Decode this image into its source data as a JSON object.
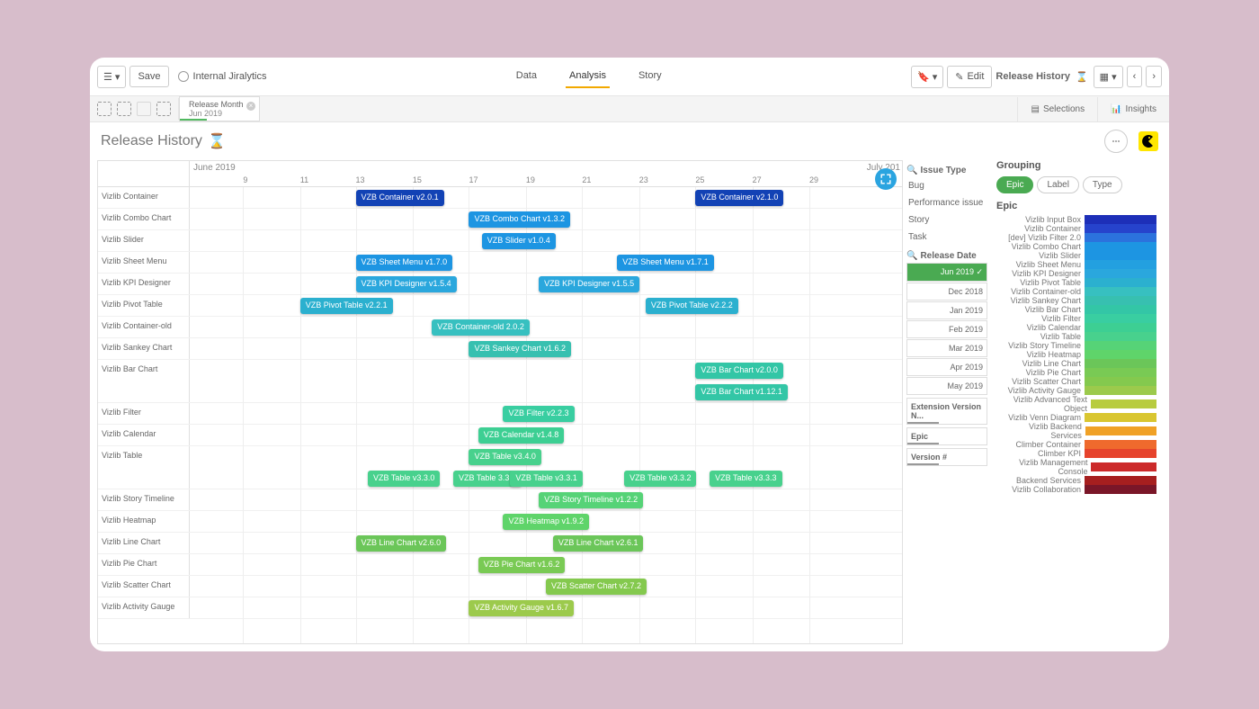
{
  "toolbar": {
    "save": "Save",
    "app": "Internal Jiralytics",
    "nav": [
      "Data",
      "Analysis",
      "Story"
    ],
    "edit": "Edit",
    "crumb": "Release History",
    "selections": "Selections",
    "insights": "Insights"
  },
  "chip": {
    "label": "Release Month",
    "value": "Jun 2019"
  },
  "title": "Release History",
  "axis": {
    "month": "June 2019",
    "month2": "July 201",
    "days": [
      {
        "d": "9",
        "p": 7.5
      },
      {
        "d": "11",
        "p": 15.5
      },
      {
        "d": "13",
        "p": 23.3
      },
      {
        "d": "15",
        "p": 31.3
      },
      {
        "d": "17",
        "p": 39.2
      },
      {
        "d": "19",
        "p": 47.2
      },
      {
        "d": "21",
        "p": 55.1
      },
      {
        "d": "23",
        "p": 63.1
      },
      {
        "d": "25",
        "p": 71.0
      },
      {
        "d": "27",
        "p": 79.0
      },
      {
        "d": "29",
        "p": 87.0
      }
    ]
  },
  "rows": [
    {
      "label": "Vizlib Container",
      "h": 24,
      "ev": [
        {
          "t": "VZB Container v2.0.1",
          "x": 23.3,
          "c": "#1242b5"
        },
        {
          "t": "VZB Container v2.1.0",
          "x": 71.0,
          "c": "#1242b5"
        }
      ]
    },
    {
      "label": "Vizlib Combo Chart",
      "h": 24,
      "ev": [
        {
          "t": "VZB Combo Chart v1.3.2",
          "x": 39.2,
          "c": "#1d95e2"
        }
      ]
    },
    {
      "label": "Vizlib Slider",
      "h": 24,
      "ev": [
        {
          "t": "VZB Slider v1.0.4",
          "x": 41.0,
          "c": "#1d95e2"
        }
      ]
    },
    {
      "label": "Vizlib Sheet Menu",
      "h": 24,
      "ev": [
        {
          "t": "VZB Sheet Menu v1.7.0",
          "x": 23.3,
          "c": "#1d95e2"
        },
        {
          "t": "VZB Sheet Menu v1.7.1",
          "x": 60.0,
          "c": "#1d95e2"
        }
      ]
    },
    {
      "label": "Vizlib KPI Designer",
      "h": 24,
      "ev": [
        {
          "t": "VZB KPI Designer v1.5.4",
          "x": 23.3,
          "c": "#2aa7dd"
        },
        {
          "t": "VZB KPI Designer v1.5.5",
          "x": 49.0,
          "c": "#2aa7dd"
        }
      ]
    },
    {
      "label": "Vizlib Pivot Table",
      "h": 24,
      "ev": [
        {
          "t": "VZB Pivot Table v2.2.1",
          "x": 15.5,
          "c": "#2bb0cf"
        },
        {
          "t": "VZB Pivot Table v2.2.2",
          "x": 64.0,
          "c": "#2bb0cf"
        }
      ]
    },
    {
      "label": "Vizlib Container-old",
      "h": 24,
      "ev": [
        {
          "t": "VZB Container-old 2.0.2",
          "x": 34.0,
          "c": "#37c0c0"
        }
      ]
    },
    {
      "label": "Vizlib Sankey Chart",
      "h": 24,
      "ev": [
        {
          "t": "VZB Sankey Chart v1.6.2",
          "x": 39.2,
          "c": "#37c0b0"
        }
      ]
    },
    {
      "label": "Vizlib Bar Chart",
      "h": 48,
      "ev": [
        {
          "t": "VZB Bar Chart v2.0.0",
          "x": 71.0,
          "c": "#33c6a6"
        },
        {
          "t": "VZB Bar Chart v1.12.1",
          "x": 71.0,
          "y": 24,
          "c": "#33c6a6"
        }
      ]
    },
    {
      "label": "Vizlib Filter",
      "h": 24,
      "ev": [
        {
          "t": "VZB Filter v2.2.3",
          "x": 44.0,
          "c": "#39cea1"
        }
      ]
    },
    {
      "label": "Vizlib Calendar",
      "h": 24,
      "ev": [
        {
          "t": "VZB Calendar v1.4.8",
          "x": 40.5,
          "c": "#3dcf93"
        }
      ]
    },
    {
      "label": "Vizlib Table",
      "h": 48,
      "ev": [
        {
          "t": "VZB Table v3.4.0",
          "x": 39.2,
          "c": "#48d18d"
        },
        {
          "t": "VZB Table v3.3.0",
          "x": 25.0,
          "y": 24,
          "c": "#48d18d"
        },
        {
          "t": "VZB Table 3.3.0",
          "x": 37.0,
          "y": 24,
          "c": "#48d18d"
        },
        {
          "t": "VZB Table v3.3.1",
          "x": 45.0,
          "y": 24,
          "c": "#48d18d"
        },
        {
          "t": "VZB Table v3.3.2",
          "x": 61.0,
          "y": 24,
          "c": "#48d18d"
        },
        {
          "t": "VZB Table v3.3.3",
          "x": 73.0,
          "y": 24,
          "c": "#48d18d"
        }
      ]
    },
    {
      "label": "Vizlib Story Timeline",
      "h": 24,
      "ev": [
        {
          "t": "VZB Story Timeline v1.2.2",
          "x": 49.0,
          "c": "#56d377"
        }
      ]
    },
    {
      "label": "Vizlib Heatmap",
      "h": 24,
      "ev": [
        {
          "t": "VZB Heatmap v1.9.2",
          "x": 44.0,
          "c": "#5fd46a"
        }
      ]
    },
    {
      "label": "Vizlib Line Chart",
      "h": 24,
      "ev": [
        {
          "t": "VZB Line Chart v2.6.0",
          "x": 23.3,
          "c": "#6bc659"
        },
        {
          "t": "VZB Line Chart v2.6.1",
          "x": 51.0,
          "c": "#6bc659"
        }
      ]
    },
    {
      "label": "Vizlib Pie Chart",
      "h": 24,
      "ev": [
        {
          "t": "VZB Pie Chart v1.6.2",
          "x": 40.5,
          "c": "#79ca54"
        }
      ]
    },
    {
      "label": "Vizlib Scatter Chart",
      "h": 24,
      "ev": [
        {
          "t": "VZB Scatter Chart v2.7.2",
          "x": 50.0,
          "c": "#84c94e"
        }
      ]
    },
    {
      "label": "Vizlib Activity Gauge",
      "h": 24,
      "ev": [
        {
          "t": "VZB Activity Gauge v1.6.7",
          "x": 39.2,
          "c": "#9cca4c"
        }
      ]
    }
  ],
  "issueType": {
    "title": "Issue Type",
    "items": [
      "Bug",
      "Performance issue",
      "Story",
      "Task"
    ]
  },
  "releaseDate": {
    "title": "Release Date",
    "items": [
      {
        "t": "Jun 2019",
        "on": true
      },
      {
        "t": "Dec 2018"
      },
      {
        "t": "Jan 2019"
      },
      {
        "t": "Feb 2019"
      },
      {
        "t": "Mar 2019"
      },
      {
        "t": "Apr 2019"
      },
      {
        "t": "May 2019"
      }
    ]
  },
  "sidePanels": [
    "Extension Version N...",
    "Epic",
    "Version #"
  ],
  "grouping": {
    "title": "Grouping",
    "pills": [
      {
        "t": "Epic",
        "on": true
      },
      {
        "t": "Label"
      },
      {
        "t": "Type"
      }
    ],
    "sub": "Epic"
  },
  "legend": [
    {
      "t": "Vizlib Input Box",
      "c": "#1d2fb8"
    },
    {
      "t": "Vizlib Container",
      "c": "#2643cc"
    },
    {
      "t": "[dev] Vizlib Filter 2.0",
      "c": "#2b72dd"
    },
    {
      "t": "Vizlib Combo Chart",
      "c": "#1d95e2"
    },
    {
      "t": "Vizlib Slider",
      "c": "#1d95e2"
    },
    {
      "t": "Vizlib Sheet Menu",
      "c": "#23a0e0"
    },
    {
      "t": "Vizlib KPI Designer",
      "c": "#2aa7dd"
    },
    {
      "t": "Vizlib Pivot Table",
      "c": "#2bb0cf"
    },
    {
      "t": "Vizlib Container-old",
      "c": "#37c0c0"
    },
    {
      "t": "Vizlib Sankey Chart",
      "c": "#37c0b0"
    },
    {
      "t": "Vizlib Bar Chart",
      "c": "#33c6a6"
    },
    {
      "t": "Vizlib Filter",
      "c": "#39cea1"
    },
    {
      "t": "Vizlib Calendar",
      "c": "#3dcf93"
    },
    {
      "t": "Vizlib Table",
      "c": "#48d18d"
    },
    {
      "t": "Vizlib Story Timeline",
      "c": "#56d377"
    },
    {
      "t": "Vizlib Heatmap",
      "c": "#5fd46a"
    },
    {
      "t": "Vizlib Line Chart",
      "c": "#6bc659"
    },
    {
      "t": "Vizlib Pie Chart",
      "c": "#79ca54"
    },
    {
      "t": "Vizlib Scatter Chart",
      "c": "#84c94e"
    },
    {
      "t": "Vizlib Activity Gauge",
      "c": "#9cca4c"
    },
    {
      "t": "Vizlib Advanced Text Object",
      "c": "#b8cc3f"
    },
    {
      "t": "Vizlib Venn Diagram",
      "c": "#d9c630"
    },
    {
      "t": "Vizlib Backend Services",
      "c": "#f0a126"
    },
    {
      "t": "Climber Container",
      "c": "#ef6a2d"
    },
    {
      "t": "Climber KPI",
      "c": "#e6432c"
    },
    {
      "t": "Vizlib Management Console",
      "c": "#cc2a2a"
    },
    {
      "t": "Backend Services",
      "c": "#a61f1f"
    },
    {
      "t": "Vizlib Collaboration",
      "c": "#7a1628"
    }
  ],
  "chart_data": {
    "type": "gantt",
    "title": "Release History",
    "x_axis": {
      "start": "2019-06-07",
      "end": "2019-07-01",
      "tick_labels": [
        "9",
        "11",
        "13",
        "15",
        "17",
        "19",
        "21",
        "23",
        "25",
        "27",
        "29"
      ]
    },
    "rows": "see top-level rows[] — label is the epic, ev[] are release events with name t at day-position x (percent of axis width)",
    "legend": "see top-level legend[] — epic name to color mapping"
  }
}
